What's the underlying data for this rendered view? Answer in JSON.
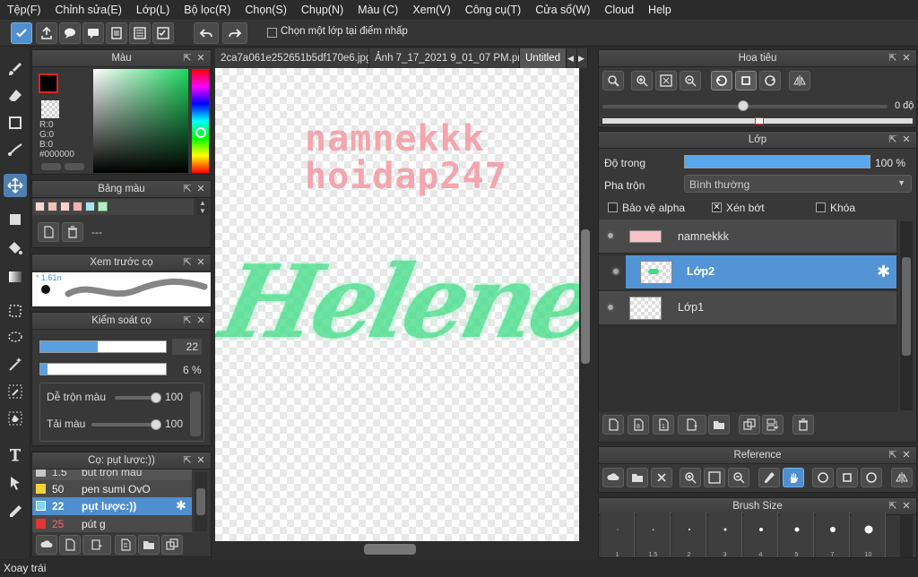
{
  "menu": [
    "Tệp(F)",
    "Chỉnh sửa(E)",
    "Lớp(L)",
    "Bộ lọc(R)",
    "Chọn(S)",
    "Chụp(N)",
    "Màu (C)",
    "Xem(V)",
    "Công cụ(T)",
    "Cửa sổ(W)",
    "Cloud",
    "Help"
  ],
  "toolbar": {
    "checkbox_label": "Chọn một lớp tại điểm nhấp"
  },
  "tabs": [
    "2ca7a061e252651b5df170e6.jpg",
    "Ảnh 7_17_2021 9_01_07 PM.png",
    "Untitled"
  ],
  "color_panel": {
    "title": "Màu",
    "r": "R:0",
    "g": "G:0",
    "b": "B:0",
    "hex": "#000000"
  },
  "palette_panel": {
    "title": "Bảng màu",
    "name": "---",
    "swatch_colors": [
      "#f9d6cf",
      "#f5c0b4",
      "#ffd0c4",
      "#f7b0b0",
      "#a9e4f3",
      "#bfe8d0"
    ]
  },
  "brush_preview": {
    "title": "Xem trước cọ",
    "size": "* 1.61n"
  },
  "brush_control": {
    "title": "Kiểm soát cọ",
    "size": "22",
    "opacity": "6 %",
    "blend_label": "Dễ trộn màu",
    "blend_value": "100",
    "load_label": "Tải màu",
    "load_value": "100",
    "size_fraction": 0.46,
    "opacity_fraction": 0.06,
    "blend_fraction": 1,
    "load_fraction": 1
  },
  "brush_list": {
    "title": "Cọ: pụt lược:))",
    "items": [
      {
        "size": "1.5",
        "name": "bút trộn màu",
        "color": "#c8c8c8"
      },
      {
        "size": "50",
        "name": "pen sumi OvO",
        "color": "#f2d23a"
      },
      {
        "size": "22",
        "name": "pụt lược:))",
        "color": "#7fd6f2"
      },
      {
        "size": "25",
        "name": "pút g",
        "color": "#e63333"
      }
    ]
  },
  "canvas": {
    "text_line1": "namnekkk",
    "text_line2": "hoidap247",
    "script_text": "Helenest"
  },
  "navigator": {
    "title": "Hoa tiêu",
    "angle": "0 độ"
  },
  "layer_panel": {
    "title": "Lớp",
    "opacity_label": "Độ trong",
    "opacity_value": "100 %",
    "opacity_fraction": 1,
    "blend_label": "Pha trộn",
    "blend_mode": "Bình thường",
    "protect_alpha": "Bảo vệ alpha",
    "clipping": "Xén bớt",
    "lock": "Khóa",
    "layers": [
      {
        "name": "namnekkk"
      },
      {
        "name": "Lớp2"
      },
      {
        "name": "Lớp1"
      }
    ]
  },
  "reference_panel": {
    "title": "Reference"
  },
  "brush_size_panel": {
    "title": "Brush Size",
    "sizes": [
      "1",
      "1.5",
      "2",
      "3",
      "4",
      "5",
      "7",
      "10"
    ]
  },
  "status": "Xoay trái",
  "colors": {
    "accent": "#4f8fd0",
    "canvas_pink": "#f4a5ad",
    "canvas_green": "#3ddc84"
  }
}
